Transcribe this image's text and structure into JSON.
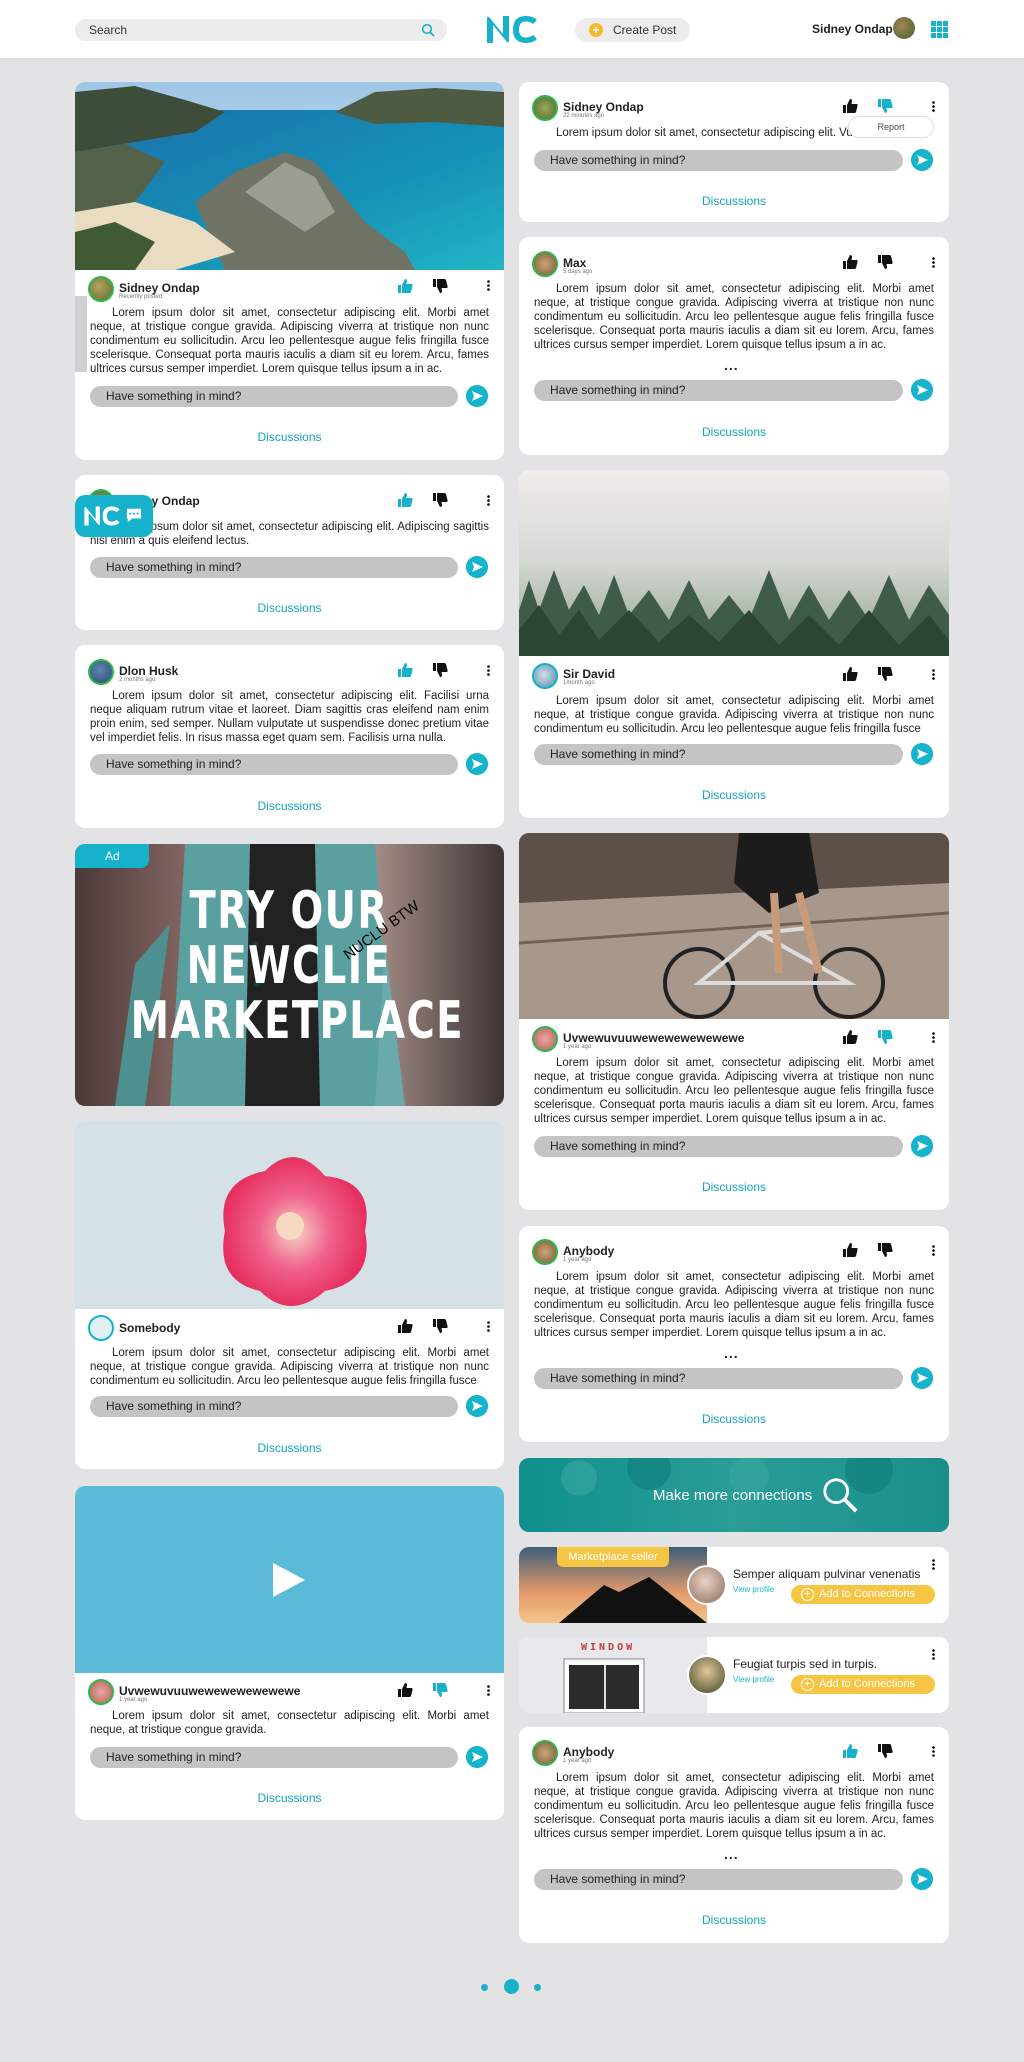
{
  "topbar": {
    "search_placeholder": "Search",
    "create_post": "Create Post",
    "user_name": "Sidney Ondap"
  },
  "common": {
    "comment_placeholder": "Have something in mind?",
    "discussions": "Discussions",
    "report": "Report",
    "more": "..."
  },
  "left": [
    {
      "name": "Sidney Ondap",
      "time": "Recently posted",
      "text": "Lorem ipsum dolor sit amet, consectetur adipiscing elit. Morbi amet neque, at tristique congue gravida. Adipiscing viverra at tristique non nunc condimentum eu sollicitudin. Arcu leo pellentesque augue felis fringilla fusce scelerisque. Consequat porta mauris iaculis a diam sit eu lorem. Arcu, fames ultrices cursus semper imperdiet. Lorem quisque tellus ipsum a in ac."
    },
    {
      "name": "Sidney Ondap",
      "time": "",
      "text": "Lorem ipsum dolor sit amet, consectetur adipiscing elit. Adipiscing sagittis nisl enim a quis eleifend lectus."
    },
    {
      "name": "Dlon Husk",
      "time": "2 months ago",
      "text": "Lorem ipsum dolor sit amet, consectetur adipiscing elit. Facilisi urna neque aliquam rutrum vitae et laoreet. Diam sagittis cras eleifend nam enim proin enim, sed semper. Nullam vulputate ut suspendisse donec pretium vitae vel imperdiet felis. In risus massa eget quam sem. Facilisis urna nulla."
    },
    {
      "name": "Somebody",
      "time": "1 year ago",
      "text": "Lorem ipsum dolor sit amet, consectetur adipiscing elit. Morbi amet neque, at tristique congue gravida. Adipiscing viverra at tristique non nunc condimentum eu sollicitudin. Arcu leo pellentesque augue felis fringilla fusce"
    },
    {
      "name": "Uvwewuvuuwewewewewewewe",
      "time": "1 year ago",
      "text": "Lorem ipsum dolor sit amet, consectetur adipiscing elit. Morbi amet neque, at tristique congue gravida."
    }
  ],
  "ad": {
    "tag": "Ad",
    "line1": "TRY OUR",
    "line2": "NEWCLIE",
    "line3": "MARKETPLACE",
    "stamp": "NUCLU BTW"
  },
  "right": [
    {
      "name": "Sidney Ondap",
      "time": "22 minutes ago",
      "text": "Lorem ipsum dolor sit amet, consectetur adipiscing elit. Vu"
    },
    {
      "name": "Max",
      "time": "5 days ago",
      "text": "Lorem ipsum dolor sit amet, consectetur adipiscing elit. Morbi amet neque, at tristique congue gravida. Adipiscing viverra at tristique non nunc condimentum eu sollicitudin. Arcu leo pellentesque augue felis fringilla fusce scelerisque. Consequat porta mauris iaculis a diam sit eu lorem. Arcu, fames ultrices cursus semper imperdiet. Lorem quisque tellus ipsum a in ac."
    },
    {
      "name": "Sir David",
      "time": "1month ago",
      "text": "Lorem ipsum dolor sit amet, consectetur adipiscing elit. Morbi amet neque, at tristique congue gravida. Adipiscing viverra at tristique non nunc condimentum eu sollicitudin. Arcu leo pellentesque augue felis fringilla fusce"
    },
    {
      "name": "Uvwewuvuuwewewewewewewe",
      "time": "1 year ago",
      "text": "Lorem ipsum dolor sit amet, consectetur adipiscing elit. Morbi amet neque, at tristique congue gravida. Adipiscing viverra at tristique non nunc condimentum eu sollicitudin. Arcu leo pellentesque augue felis fringilla fusce scelerisque. Consequat porta mauris iaculis a diam sit eu lorem. Arcu, fames ultrices cursus semper imperdiet. Lorem quisque tellus ipsum a in ac."
    },
    {
      "name": "Anybody",
      "time": "1 year ago",
      "text": "Lorem ipsum dolor sit amet, consectetur adipiscing elit. Morbi amet neque, at tristique congue gravida. Adipiscing viverra at tristique non nunc condimentum eu sollicitudin. Arcu leo pellentesque augue felis fringilla fusce scelerisque. Consequat porta mauris iaculis a diam sit eu lorem. Arcu, fames ultrices cursus semper imperdiet. Lorem quisque tellus ipsum a in ac."
    },
    {
      "name": "Anybody",
      "time": "1 year ago",
      "text": "Lorem ipsum dolor sit amet, consectetur adipiscing elit. Morbi amet neque, at tristique congue gravida. Adipiscing viverra at tristique non nunc condimentum eu sollicitudin. Arcu leo pellentesque augue felis fringilla fusce scelerisque. Consequat porta mauris iaculis a diam sit eu lorem. Arcu, fames ultrices cursus semper imperdiet. Lorem quisque tellus ipsum a in ac."
    }
  ],
  "connections": {
    "label": "Make more connections"
  },
  "sellers": [
    {
      "tag": "Marketplace seller",
      "name": "Semper aliquam pulvinar venenatis",
      "view": "View profile",
      "add": "Add to Connections"
    },
    {
      "tag": "",
      "sign": "WINDOW",
      "name": "Feugiat turpis sed in turpis.",
      "view": "View profile",
      "add": "Add to Connections"
    }
  ],
  "colors": {
    "accent": "#16b2cc",
    "yellow": "#f7c544",
    "background": "#e3e3e5"
  }
}
